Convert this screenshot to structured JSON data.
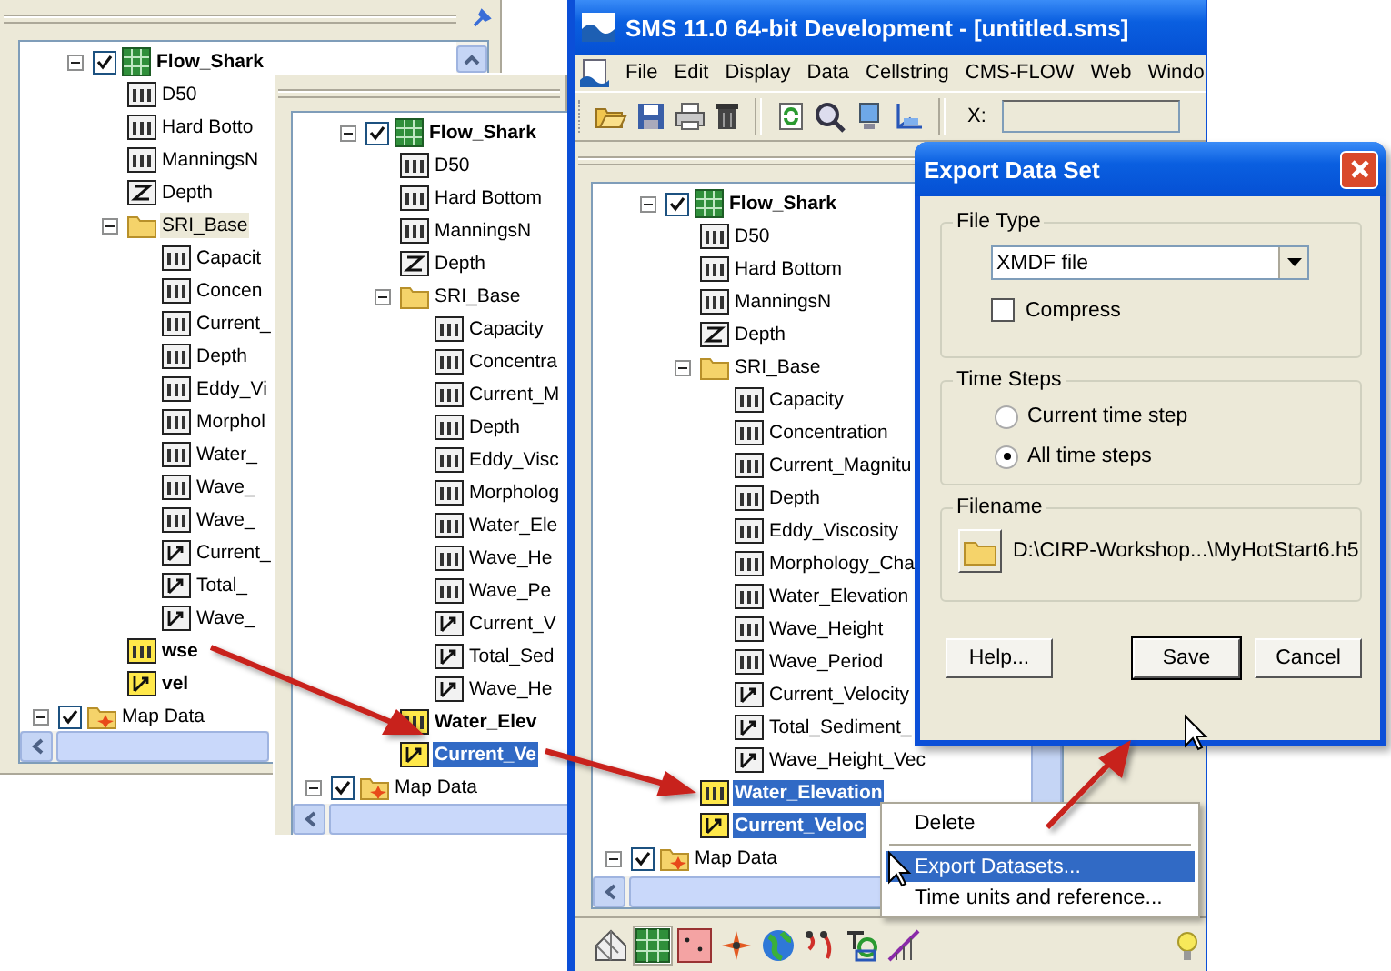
{
  "panels": [
    {
      "focused": false,
      "tree": [
        {
          "label": "Flow_Shark",
          "kind": "grid",
          "checked": true,
          "expanded": true,
          "active": true,
          "selected": false,
          "children": [
            {
              "label": "D50",
              "kind": "scalar",
              "active": false,
              "selected": false
            },
            {
              "label": "Hard Botto",
              "kind": "scalar",
              "active": false,
              "selected": false
            },
            {
              "label": "ManningsN",
              "kind": "scalar",
              "active": false,
              "selected": false
            },
            {
              "label": "Depth",
              "kind": "z",
              "active": false,
              "selected": false
            },
            {
              "label": "SRI_Base",
              "kind": "folder",
              "expanded": true,
              "active": false,
              "selected": true,
              "children": [
                {
                  "label": "Capacit",
                  "kind": "scalar",
                  "active": false,
                  "selected": false
                },
                {
                  "label": "Concen",
                  "kind": "scalar",
                  "active": false,
                  "selected": false
                },
                {
                  "label": "Current_",
                  "kind": "scalar",
                  "active": false,
                  "selected": false
                },
                {
                  "label": "Depth",
                  "kind": "scalar",
                  "active": false,
                  "selected": false
                },
                {
                  "label": "Eddy_Vi",
                  "kind": "scalar",
                  "active": false,
                  "selected": false
                },
                {
                  "label": "Morphol",
                  "kind": "scalar",
                  "active": false,
                  "selected": false
                },
                {
                  "label": "Water_",
                  "kind": "scalar",
                  "active": false,
                  "selected": false
                },
                {
                  "label": "Wave_",
                  "kind": "scalar",
                  "active": false,
                  "selected": false
                },
                {
                  "label": "Wave_",
                  "kind": "scalar",
                  "active": false,
                  "selected": false
                },
                {
                  "label": "Current_",
                  "kind": "vector",
                  "active": false,
                  "selected": false
                },
                {
                  "label": "Total_",
                  "kind": "vector",
                  "active": false,
                  "selected": false
                },
                {
                  "label": "Wave_",
                  "kind": "vector",
                  "active": false,
                  "selected": false
                }
              ]
            },
            {
              "label": "wse",
              "kind": "scalar",
              "active": true,
              "selected": false
            },
            {
              "label": "vel",
              "kind": "vector",
              "active": true,
              "selected": false
            }
          ]
        }
      ],
      "map_data": {
        "label": "Map Data",
        "kind": "map",
        "checked": true,
        "expanded": true,
        "active": false,
        "selected": false
      }
    },
    {
      "focused": true,
      "tree": [
        {
          "label": "Flow_Shark",
          "kind": "grid",
          "checked": true,
          "expanded": true,
          "active": true,
          "selected": false,
          "children": [
            {
              "label": "D50",
              "kind": "scalar",
              "active": false,
              "selected": false
            },
            {
              "label": "Hard Bottom",
              "kind": "scalar",
              "active": false,
              "selected": false
            },
            {
              "label": "ManningsN",
              "kind": "scalar",
              "active": false,
              "selected": false
            },
            {
              "label": "Depth",
              "kind": "z",
              "active": false,
              "selected": false
            },
            {
              "label": "SRI_Base",
              "kind": "folder",
              "expanded": true,
              "active": false,
              "selected": false,
              "children": [
                {
                  "label": "Capacity",
                  "kind": "scalar",
                  "active": false,
                  "selected": false
                },
                {
                  "label": "Concentra",
                  "kind": "scalar",
                  "active": false,
                  "selected": false
                },
                {
                  "label": "Current_M",
                  "kind": "scalar",
                  "active": false,
                  "selected": false
                },
                {
                  "label": "Depth",
                  "kind": "scalar",
                  "active": false,
                  "selected": false
                },
                {
                  "label": "Eddy_Visc",
                  "kind": "scalar",
                  "active": false,
                  "selected": false
                },
                {
                  "label": "Morpholog",
                  "kind": "scalar",
                  "active": false,
                  "selected": false
                },
                {
                  "label": "Water_Ele",
                  "kind": "scalar",
                  "active": false,
                  "selected": false
                },
                {
                  "label": "Wave_He",
                  "kind": "scalar",
                  "active": false,
                  "selected": false
                },
                {
                  "label": "Wave_Pe",
                  "kind": "scalar",
                  "active": false,
                  "selected": false
                },
                {
                  "label": "Current_V",
                  "kind": "vector",
                  "active": false,
                  "selected": false
                },
                {
                  "label": "Total_Sed",
                  "kind": "vector",
                  "active": false,
                  "selected": false
                },
                {
                  "label": "Wave_He",
                  "kind": "vector",
                  "active": false,
                  "selected": false
                }
              ]
            },
            {
              "label": "Water_Elev",
              "kind": "scalar",
              "active": true,
              "selected": false
            },
            {
              "label": "Current_Ve",
              "kind": "vector",
              "active": true,
              "selected": true
            }
          ]
        }
      ],
      "map_data": {
        "label": "Map Data",
        "kind": "map",
        "checked": true,
        "expanded": true,
        "active": false,
        "selected": false
      }
    },
    {
      "focused": true,
      "tree": [
        {
          "label": "Flow_Shark",
          "kind": "grid",
          "checked": true,
          "expanded": true,
          "active": true,
          "selected": false,
          "children": [
            {
              "label": "D50",
              "kind": "scalar",
              "active": false,
              "selected": false
            },
            {
              "label": "Hard Bottom",
              "kind": "scalar",
              "active": false,
              "selected": false
            },
            {
              "label": "ManningsN",
              "kind": "scalar",
              "active": false,
              "selected": false
            },
            {
              "label": "Depth",
              "kind": "z",
              "active": false,
              "selected": false
            },
            {
              "label": "SRI_Base",
              "kind": "folder",
              "expanded": true,
              "active": false,
              "selected": false,
              "children": [
                {
                  "label": "Capacity",
                  "kind": "scalar",
                  "active": false,
                  "selected": false
                },
                {
                  "label": "Concentration",
                  "kind": "scalar",
                  "active": false,
                  "selected": false
                },
                {
                  "label": "Current_Magnitu",
                  "kind": "scalar",
                  "active": false,
                  "selected": false
                },
                {
                  "label": "Depth",
                  "kind": "scalar",
                  "active": false,
                  "selected": false
                },
                {
                  "label": "Eddy_Viscosity",
                  "kind": "scalar",
                  "active": false,
                  "selected": false
                },
                {
                  "label": "Morphology_Cha",
                  "kind": "scalar",
                  "active": false,
                  "selected": false
                },
                {
                  "label": "Water_Elevation",
                  "kind": "scalar",
                  "active": false,
                  "selected": false
                },
                {
                  "label": "Wave_Height",
                  "kind": "scalar",
                  "active": false,
                  "selected": false
                },
                {
                  "label": "Wave_Period",
                  "kind": "scalar",
                  "active": false,
                  "selected": false
                },
                {
                  "label": "Current_Velocity",
                  "kind": "vector",
                  "active": false,
                  "selected": false
                },
                {
                  "label": "Total_Sediment_",
                  "kind": "vector",
                  "active": false,
                  "selected": false
                },
                {
                  "label": "Wave_Height_Vec",
                  "kind": "vector",
                  "active": false,
                  "selected": false
                }
              ]
            },
            {
              "label": "Water_Elevation",
              "kind": "scalar",
              "active": true,
              "selected": true
            },
            {
              "label": "Current_Veloc",
              "kind": "vector",
              "active": true,
              "selected": true
            }
          ]
        }
      ],
      "map_data": {
        "label": "Map Data",
        "kind": "map",
        "checked": true,
        "expanded": true,
        "active": false,
        "selected": false
      }
    }
  ],
  "window": {
    "title": "SMS 11.0 64-bit Development - [untitled.sms]"
  },
  "menu": [
    "File",
    "Edit",
    "Display",
    "Data",
    "Cellstring",
    "CMS-FLOW",
    "Web",
    "Windo"
  ],
  "toolbar": {
    "x_label": "X:"
  },
  "dialog": {
    "title": "Export Data Set",
    "file_type": {
      "label": "File Type",
      "value": "XMDF file",
      "compress_label": "Compress",
      "compress_checked": false
    },
    "time_steps": {
      "label": "Time Steps",
      "options": [
        {
          "label": "Current time step",
          "selected": false
        },
        {
          "label": "All time steps",
          "selected": true
        }
      ]
    },
    "filename": {
      "label": "Filename",
      "path": "D:\\CIRP-Workshop...\\MyHotStart6.h5"
    },
    "buttons": [
      "Help...",
      "Save",
      "Cancel"
    ]
  },
  "context_menu": [
    {
      "label": "Delete",
      "selected": false
    },
    {
      "label": "Export Datasets...",
      "selected": true
    },
    {
      "label": "Time units and reference...",
      "selected": false
    }
  ]
}
